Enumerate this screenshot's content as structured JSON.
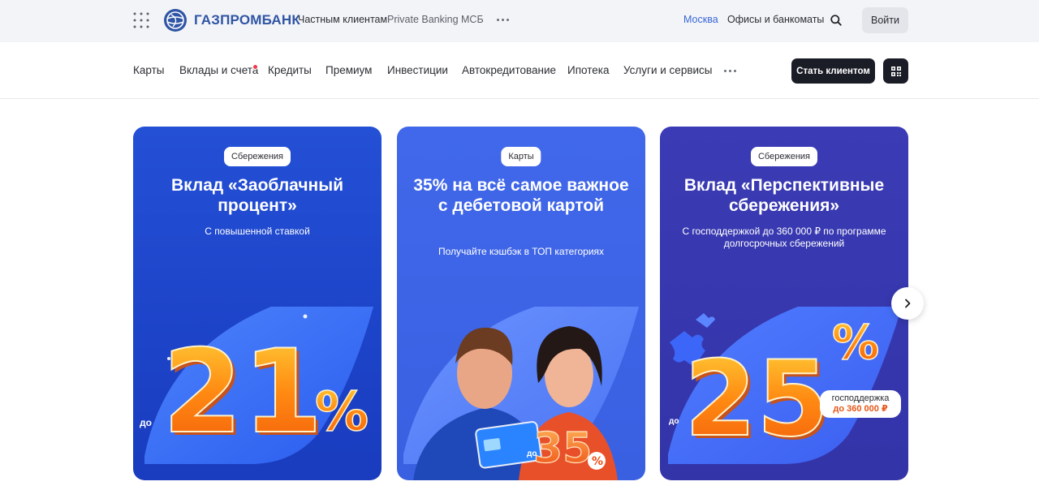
{
  "topbar": {
    "brand": "ГАЗПРОМБАНК",
    "links": [
      "Частным клиентам",
      "Private Banking",
      "МСБ"
    ],
    "city": "Москва",
    "offices": "Офисы и банкоматы",
    "login": "Войти"
  },
  "nav": {
    "items": [
      "Карты",
      "Вклады и счета",
      "Кредиты",
      "Премиум",
      "Инвестиции",
      "Автокредитование",
      "Ипотека",
      "Услуги и сервисы"
    ],
    "cta": "Стать клиентом"
  },
  "cards": [
    {
      "chip": "Сбережения",
      "title": "Вклад «Заоблачный процент»",
      "subtitle": "С повышенной ставкой",
      "prefix": "до",
      "big_number": "21",
      "percent": "%"
    },
    {
      "chip": "Карты",
      "title": "35% на всё самое важное с дебетовой картой",
      "subtitle": "Получайте кэшбэк в ТОП категориях",
      "prefix": "до",
      "big_number": "35",
      "percent": "%"
    },
    {
      "chip": "Сбережения",
      "title": "Вклад «Перспективные сбережения»",
      "subtitle": "С господдержкой до 360 000 ₽ по программе долгосрочных сбережений",
      "prefix": "до",
      "big_number": "25",
      "percent": "%",
      "badge_line1": "господдержка",
      "badge_line2": "до 360 000 ₽"
    }
  ],
  "colors": {
    "brand_blue": "#2f55a4",
    "link_blue": "#3767d6",
    "dark_button": "#1b1d26",
    "notification_dot": "#ef3b50",
    "orange_number": "#f47a14"
  }
}
